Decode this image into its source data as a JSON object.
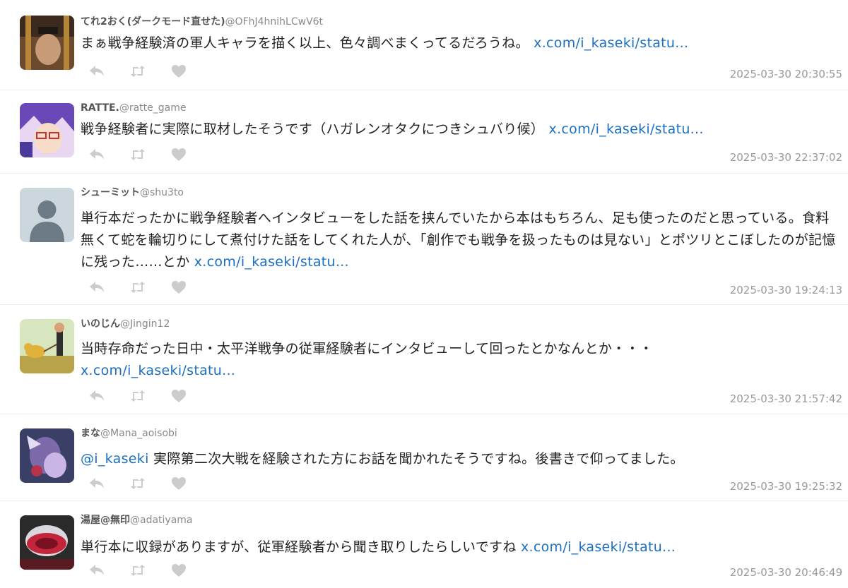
{
  "tweets": [
    {
      "name": "てれ2おく(ダークモード直せた)",
      "handle": "@OFhJ4hnihLCwV6t",
      "text": "まぁ戦争経験済の軍人キャラを描く以上、色々調べまくってるだろうね。 ",
      "link": "x.com/i_kaseki/statu...",
      "time": "2025-03-30 20:30:55"
    },
    {
      "name": "RATTE.",
      "handle": "@ratte_game",
      "text": "戦争経験者に実際に取材したそうです（ハガレンオタクにつきシュバり候） ",
      "link": "x.com/i_kaseki/statu...",
      "time": "2025-03-30 22:37:02"
    },
    {
      "name": "シューミット",
      "handle": "@shu3to",
      "text": "単行本だったかに戦争経験者へインタビューをした話を挟んでいたから本はもちろん、足も使ったのだと思っている。食料無くて蛇を輪切りにして煮付けた話をしてくれた人が、「創作でも戦争を扱ったものは見ない」とポツリとこぼしたのが記憶に残った……とか ",
      "link": "x.com/i_kaseki/statu...",
      "time": "2025-03-30 19:24:13"
    },
    {
      "name": "いのじん",
      "handle": "@Jingin12",
      "text": "当時存命だった日中・太平洋戦争の従軍経験者にインタビューして回ったとかなんとか・・・ ",
      "link": "x.com/i_kaseki/statu...",
      "time": "2025-03-30 21:57:42"
    },
    {
      "name": "まな",
      "handle": "@Mana_aoisobi",
      "mention": "@i_kaseki",
      "text": " 実際第二次大戦を経験された方にお話を聞かれたそうですね。後書きで仰ってました。",
      "link": "",
      "time": "2025-03-30 19:25:32"
    },
    {
      "name": "湯屋@無印",
      "handle": "@adatiyama",
      "text": "単行本に収録がありますが、従軍経験者から聞き取りしたらしいですね ",
      "link": "x.com/i_kaseki/statu...",
      "time": "2025-03-30 20:46:49"
    }
  ],
  "colors": {
    "link": "#1a6fc2",
    "muted": "#999999",
    "icon": "#cccccc"
  },
  "icons": [
    "reply-icon",
    "retweet-icon",
    "like-icon"
  ]
}
